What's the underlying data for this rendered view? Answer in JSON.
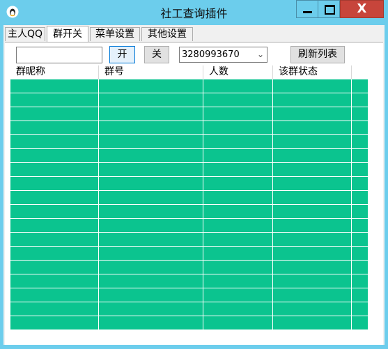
{
  "window": {
    "title": "社工查询插件",
    "close_glyph": "X",
    "app_icon": "qq-penguin-icon",
    "accent": "#6ccdec",
    "close_color": "#c7453b"
  },
  "tabs": [
    {
      "label": "主人QQ",
      "active": false
    },
    {
      "label": "群开关",
      "active": true
    },
    {
      "label": "菜单设置",
      "active": false
    },
    {
      "label": "其他设置",
      "active": false
    }
  ],
  "toolbar": {
    "input_value": "",
    "on_label": "开",
    "off_label": "关",
    "account_selected": "3280993670",
    "refresh_label": "刷新列表"
  },
  "list": {
    "columns": [
      "群昵称",
      "群号",
      "人数",
      "该群状态"
    ],
    "row_color": "#0bc48f",
    "rows": [
      [
        "",
        "",
        "",
        ""
      ],
      [
        "",
        "",
        "",
        ""
      ],
      [
        "",
        "",
        "",
        ""
      ],
      [
        "",
        "",
        "",
        ""
      ],
      [
        "",
        "",
        "",
        ""
      ],
      [
        "",
        "",
        "",
        ""
      ],
      [
        "",
        "",
        "",
        ""
      ],
      [
        "",
        "",
        "",
        ""
      ],
      [
        "",
        "",
        "",
        ""
      ],
      [
        "",
        "",
        "",
        ""
      ],
      [
        "",
        "",
        "",
        ""
      ],
      [
        "",
        "",
        "",
        ""
      ],
      [
        "",
        "",
        "",
        ""
      ],
      [
        "",
        "",
        "",
        ""
      ],
      [
        "",
        "",
        "",
        ""
      ],
      [
        "",
        "",
        "",
        ""
      ],
      [
        "",
        "",
        "",
        ""
      ],
      [
        "",
        "",
        "",
        ""
      ]
    ]
  }
}
